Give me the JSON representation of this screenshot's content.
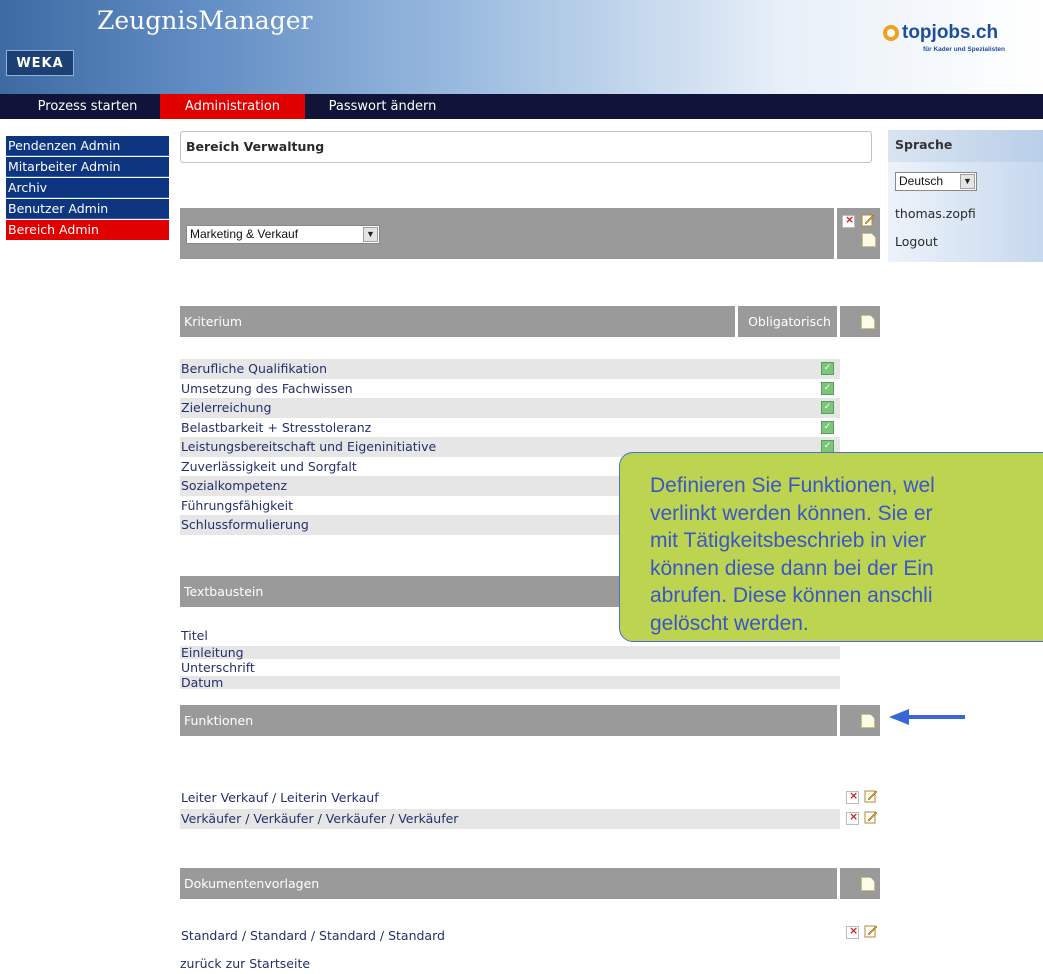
{
  "header": {
    "app_title": "ZeugnisManager",
    "weka_logo": "WEKA",
    "topjobs_name": "topjobs.ch",
    "topjobs_tagline": "für Kader und Spezialisten"
  },
  "topnav": {
    "items": [
      {
        "label": "Prozess starten",
        "active": false
      },
      {
        "label": "Administration",
        "active": true
      },
      {
        "label": "Passwort ändern",
        "active": false
      }
    ]
  },
  "sidebar": {
    "items": [
      {
        "label": "Pendenzen Admin",
        "active": false
      },
      {
        "label": "Mitarbeiter Admin",
        "active": false
      },
      {
        "label": "Archiv",
        "active": false
      },
      {
        "label": "Benutzer Admin",
        "active": false
      },
      {
        "label": "Bereich Admin",
        "active": true
      }
    ]
  },
  "main": {
    "bereich_title": "Bereich Verwaltung",
    "bereich_select": "Marketing & Verkauf",
    "kriterium": {
      "header": "Kriterium",
      "obligatorisch": "Obligatorisch",
      "items": [
        "Berufliche Qualifikation",
        "Umsetzung des Fachwissen",
        "Zielerreichung",
        "Belastbarkeit + Stresstoleranz",
        "Leistungsbereitschaft und Eigeninitiative",
        "Zuverlässigkeit und Sorgfalt",
        "Sozialkompetenz",
        "Führungsfähigkeit",
        "Schlussformulierung"
      ]
    },
    "textbaustein": {
      "header": "Textbaustein",
      "items": [
        "Titel",
        "Einleitung",
        "Unterschrift",
        "Datum"
      ]
    },
    "funktionen": {
      "header": "Funktionen",
      "items": [
        "Leiter Verkauf / Leiterin Verkauf",
        "Verkäufer / Verkäufer / Verkäufer / Verkäufer"
      ]
    },
    "dokumentenvorlagen": {
      "header": "Dokumentenvorlagen",
      "items": [
        "Standard / Standard / Standard / Standard"
      ]
    },
    "back_link": "zurück zur Startseite"
  },
  "right_panel": {
    "title": "Sprache",
    "language": "Deutsch",
    "user": "thomas.zopfi",
    "logout": "Logout"
  },
  "callout": {
    "text": "Definieren Sie Funktionen, wel\nverlinkt werden können. Sie er\nmit Tätigkeitsbeschrieb in vier \nkönnen diese dann bei der Ein\nabrufen. Diese können anschli\ngelöscht werden."
  },
  "colors": {
    "nav_bg": "#0f1438",
    "active_red": "#e00000",
    "sidebar_blue": "#0d3580",
    "section_grey": "#9a9a9a",
    "callout_green": "#bcd450",
    "callout_text": "#3a56c9",
    "arrow_blue": "#3a66d8"
  }
}
